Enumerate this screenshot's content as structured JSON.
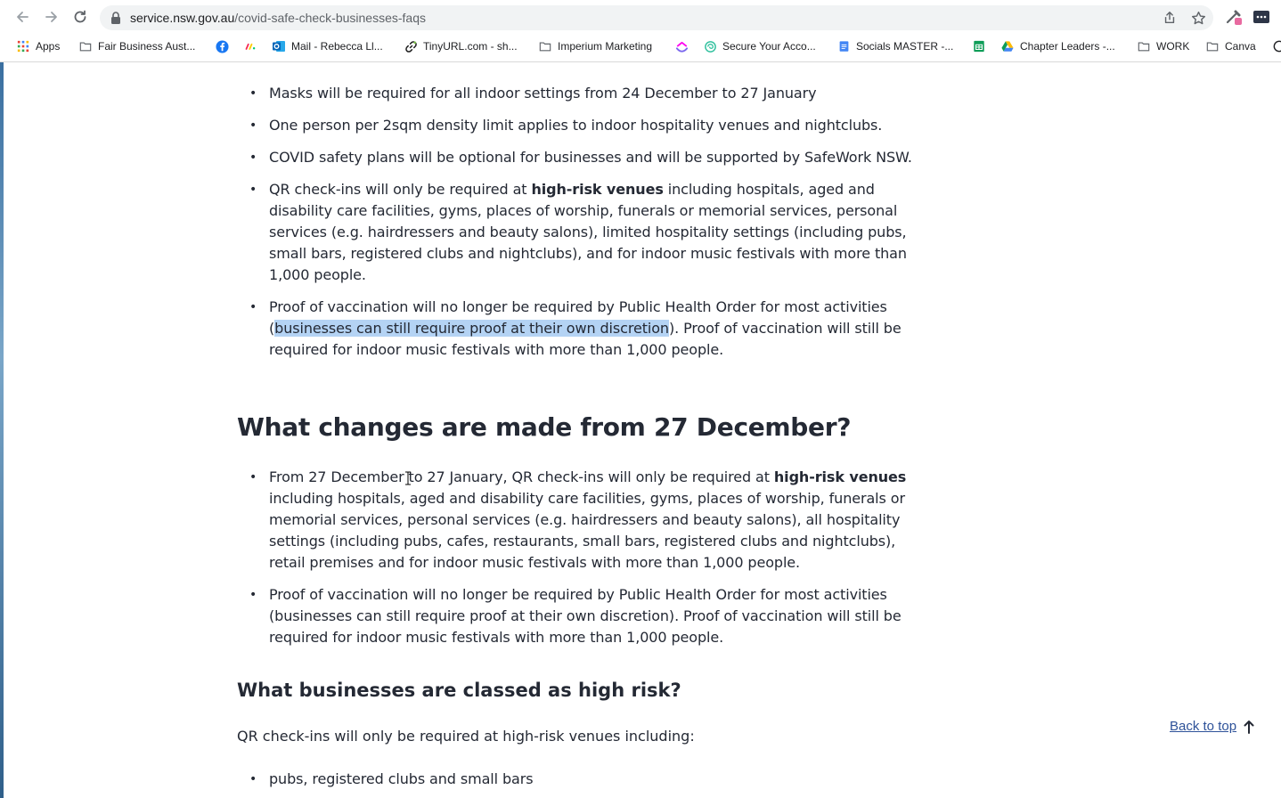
{
  "browser": {
    "url_domain": "service.nsw.gov.au",
    "url_path": "/covid-safe-check-businesses-faqs",
    "bookmarks": [
      {
        "label": "Apps",
        "icon": "apps-grid-icon"
      },
      {
        "label": "Fair Business Aust...",
        "icon": "folder-icon"
      },
      {
        "label": "",
        "icon": "facebook-icon"
      },
      {
        "label": "",
        "icon": "monday-icon"
      },
      {
        "label": "Mail - Rebecca Ll...",
        "icon": "outlook-icon"
      },
      {
        "label": "TinyURL.com - sh...",
        "icon": "tinyurl-icon"
      },
      {
        "label": "Imperium Marketing",
        "icon": "folder-icon"
      },
      {
        "label": "",
        "icon": "clickup-icon"
      },
      {
        "label": "Secure Your Acco...",
        "icon": "shield-swirl-icon"
      },
      {
        "label": "Socials MASTER -...",
        "icon": "google-docs-icon"
      },
      {
        "label": "",
        "icon": "google-sheets-icon"
      },
      {
        "label": "Chapter Leaders -...",
        "icon": "google-drive-icon"
      },
      {
        "label": "WORK",
        "icon": "folder-icon"
      },
      {
        "label": "Canva",
        "icon": "folder-icon"
      }
    ]
  },
  "section1": {
    "bullets": [
      {
        "text": "Masks will be required for all indoor settings from 24 December to 27 January"
      },
      {
        "text": "One person per 2sqm density limit applies to indoor hospitality venues and nightclubs."
      },
      {
        "text": "COVID safety plans will be optional for businesses and will be supported by SafeWork NSW."
      },
      {
        "pre": "QR check-ins will only be required at ",
        "bold": "high-risk venues",
        "post": " including hospitals, aged and disability care facilities, gyms, places of worship, funerals or memorial services, personal services (e.g. hairdressers and beauty salons), limited hospitality settings (including pubs, small bars, registered clubs and nightclubs), and for indoor music festivals with more than 1,000 people."
      },
      {
        "pre": "Proof of vaccination will no longer be required by Public Health Order for most activities (",
        "highlight": "businesses can still require proof at their own discretion",
        "post": "). Proof of vaccination will still be required for indoor music festivals with more than 1,000 people."
      }
    ]
  },
  "section2": {
    "heading": "What changes are made from 27 December?",
    "bullets": [
      {
        "pre": "From 27 December to 27 January, QR check-ins will only be required at ",
        "bold": "high-risk venues",
        "post": " including hospitals, aged and disability care facilities, gyms, places of worship, funerals or memorial services, personal services (e.g. hairdressers and beauty salons), all hospitality settings (including pubs, cafes, restaurants, small bars, registered clubs and nightclubs), retail premises and for indoor music festivals with more than 1,000 people."
      },
      {
        "text": "Proof of vaccination will no longer be required by Public Health Order for most activities (businesses can still require proof at their own discretion). Proof of vaccination will still be required for indoor music festivals with more than 1,000 people."
      }
    ]
  },
  "section3": {
    "heading": "What businesses are classed as high risk?",
    "intro": "QR check-ins will only be required at high-risk venues including:",
    "bullets": [
      {
        "text": "pubs, registered clubs and small bars"
      }
    ]
  },
  "back_to_top": "Back to top",
  "colors": {
    "text": "#242934",
    "link": "#2e5299",
    "selection": "#b4d3f4"
  }
}
